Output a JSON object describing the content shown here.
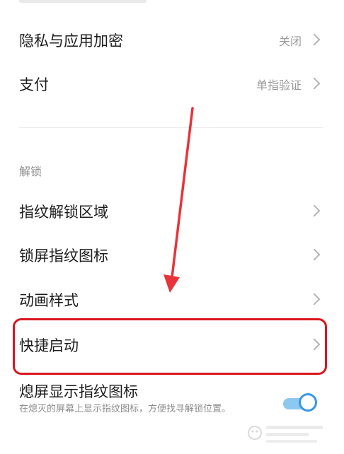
{
  "settings": {
    "rows": [
      {
        "label": "隐私与应用加密",
        "value": "关闭"
      },
      {
        "label": "支付",
        "value": "单指验证"
      }
    ]
  },
  "unlock_section": {
    "header": "解锁",
    "items": [
      {
        "label": "指纹解锁区域"
      },
      {
        "label": "锁屏指纹图标"
      },
      {
        "label": "动画样式"
      },
      {
        "label": "快捷启动"
      }
    ]
  },
  "screen_off": {
    "title": "熄屏显示指纹图标",
    "description": "在熄灭的屏幕上显示指纹图标，方便找寻解锁位置。",
    "enabled": true
  },
  "colors": {
    "highlight": "#d9161e",
    "arrow": "#e8333a",
    "toggle_on": "#3a96e6"
  },
  "icons": {
    "row_chevron": "chevron-right-icon",
    "annotation": "arrow-down-annotation-icon"
  }
}
